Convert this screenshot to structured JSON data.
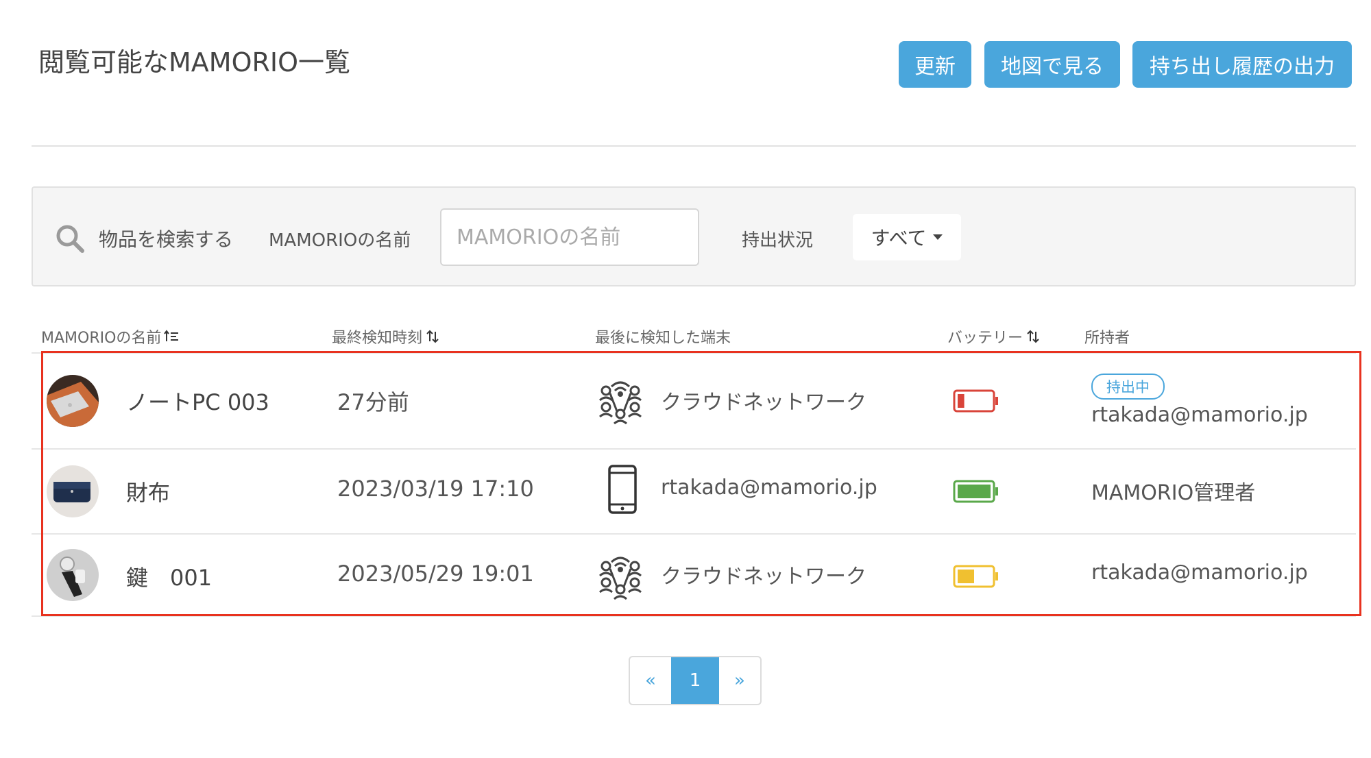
{
  "header": {
    "title": "閲覧可能なMAMORIO一覧",
    "refresh_label": "更新",
    "map_label": "地図で見る",
    "export_label": "持ち出し履歴の出力"
  },
  "search": {
    "title": "物品を検索する",
    "name_label": "MAMORIOの名前",
    "name_placeholder": "MAMORIOの名前",
    "name_value": "",
    "status_label": "持出状況",
    "status_selected": "すべて"
  },
  "table": {
    "columns": [
      "MAMORIOの名前",
      "最終検知時刻",
      "最後に検知した端末",
      "バッテリー",
      "所持者"
    ],
    "rows": [
      {
        "name": "ノートPC 003",
        "time": "27分前",
        "device_icon": "cloud-network-icon",
        "device": "クラウドネットワーク",
        "battery_level": 0.2,
        "battery_color": "#d9443a",
        "badge": "持出中",
        "owner": "rtakada@mamorio.jp"
      },
      {
        "name": "財布",
        "time": "2023/03/19 17:10",
        "device_icon": "smartphone-icon",
        "device": "rtakada@mamorio.jp",
        "battery_level": 1.0,
        "battery_color": "#5aa84a",
        "badge": "",
        "owner": "MAMORIO管理者"
      },
      {
        "name": "鍵　001",
        "time": "2023/05/29 19:01",
        "device_icon": "cloud-network-icon",
        "device": "クラウドネットワーク",
        "battery_level": 0.5,
        "battery_color": "#f0c030",
        "badge": "",
        "owner": "rtakada@mamorio.jp"
      }
    ]
  },
  "pagination": {
    "prev": "«",
    "current": "1",
    "next": "»"
  },
  "colors": {
    "accent": "#4aa6dc",
    "highlight": "#e8321f"
  }
}
